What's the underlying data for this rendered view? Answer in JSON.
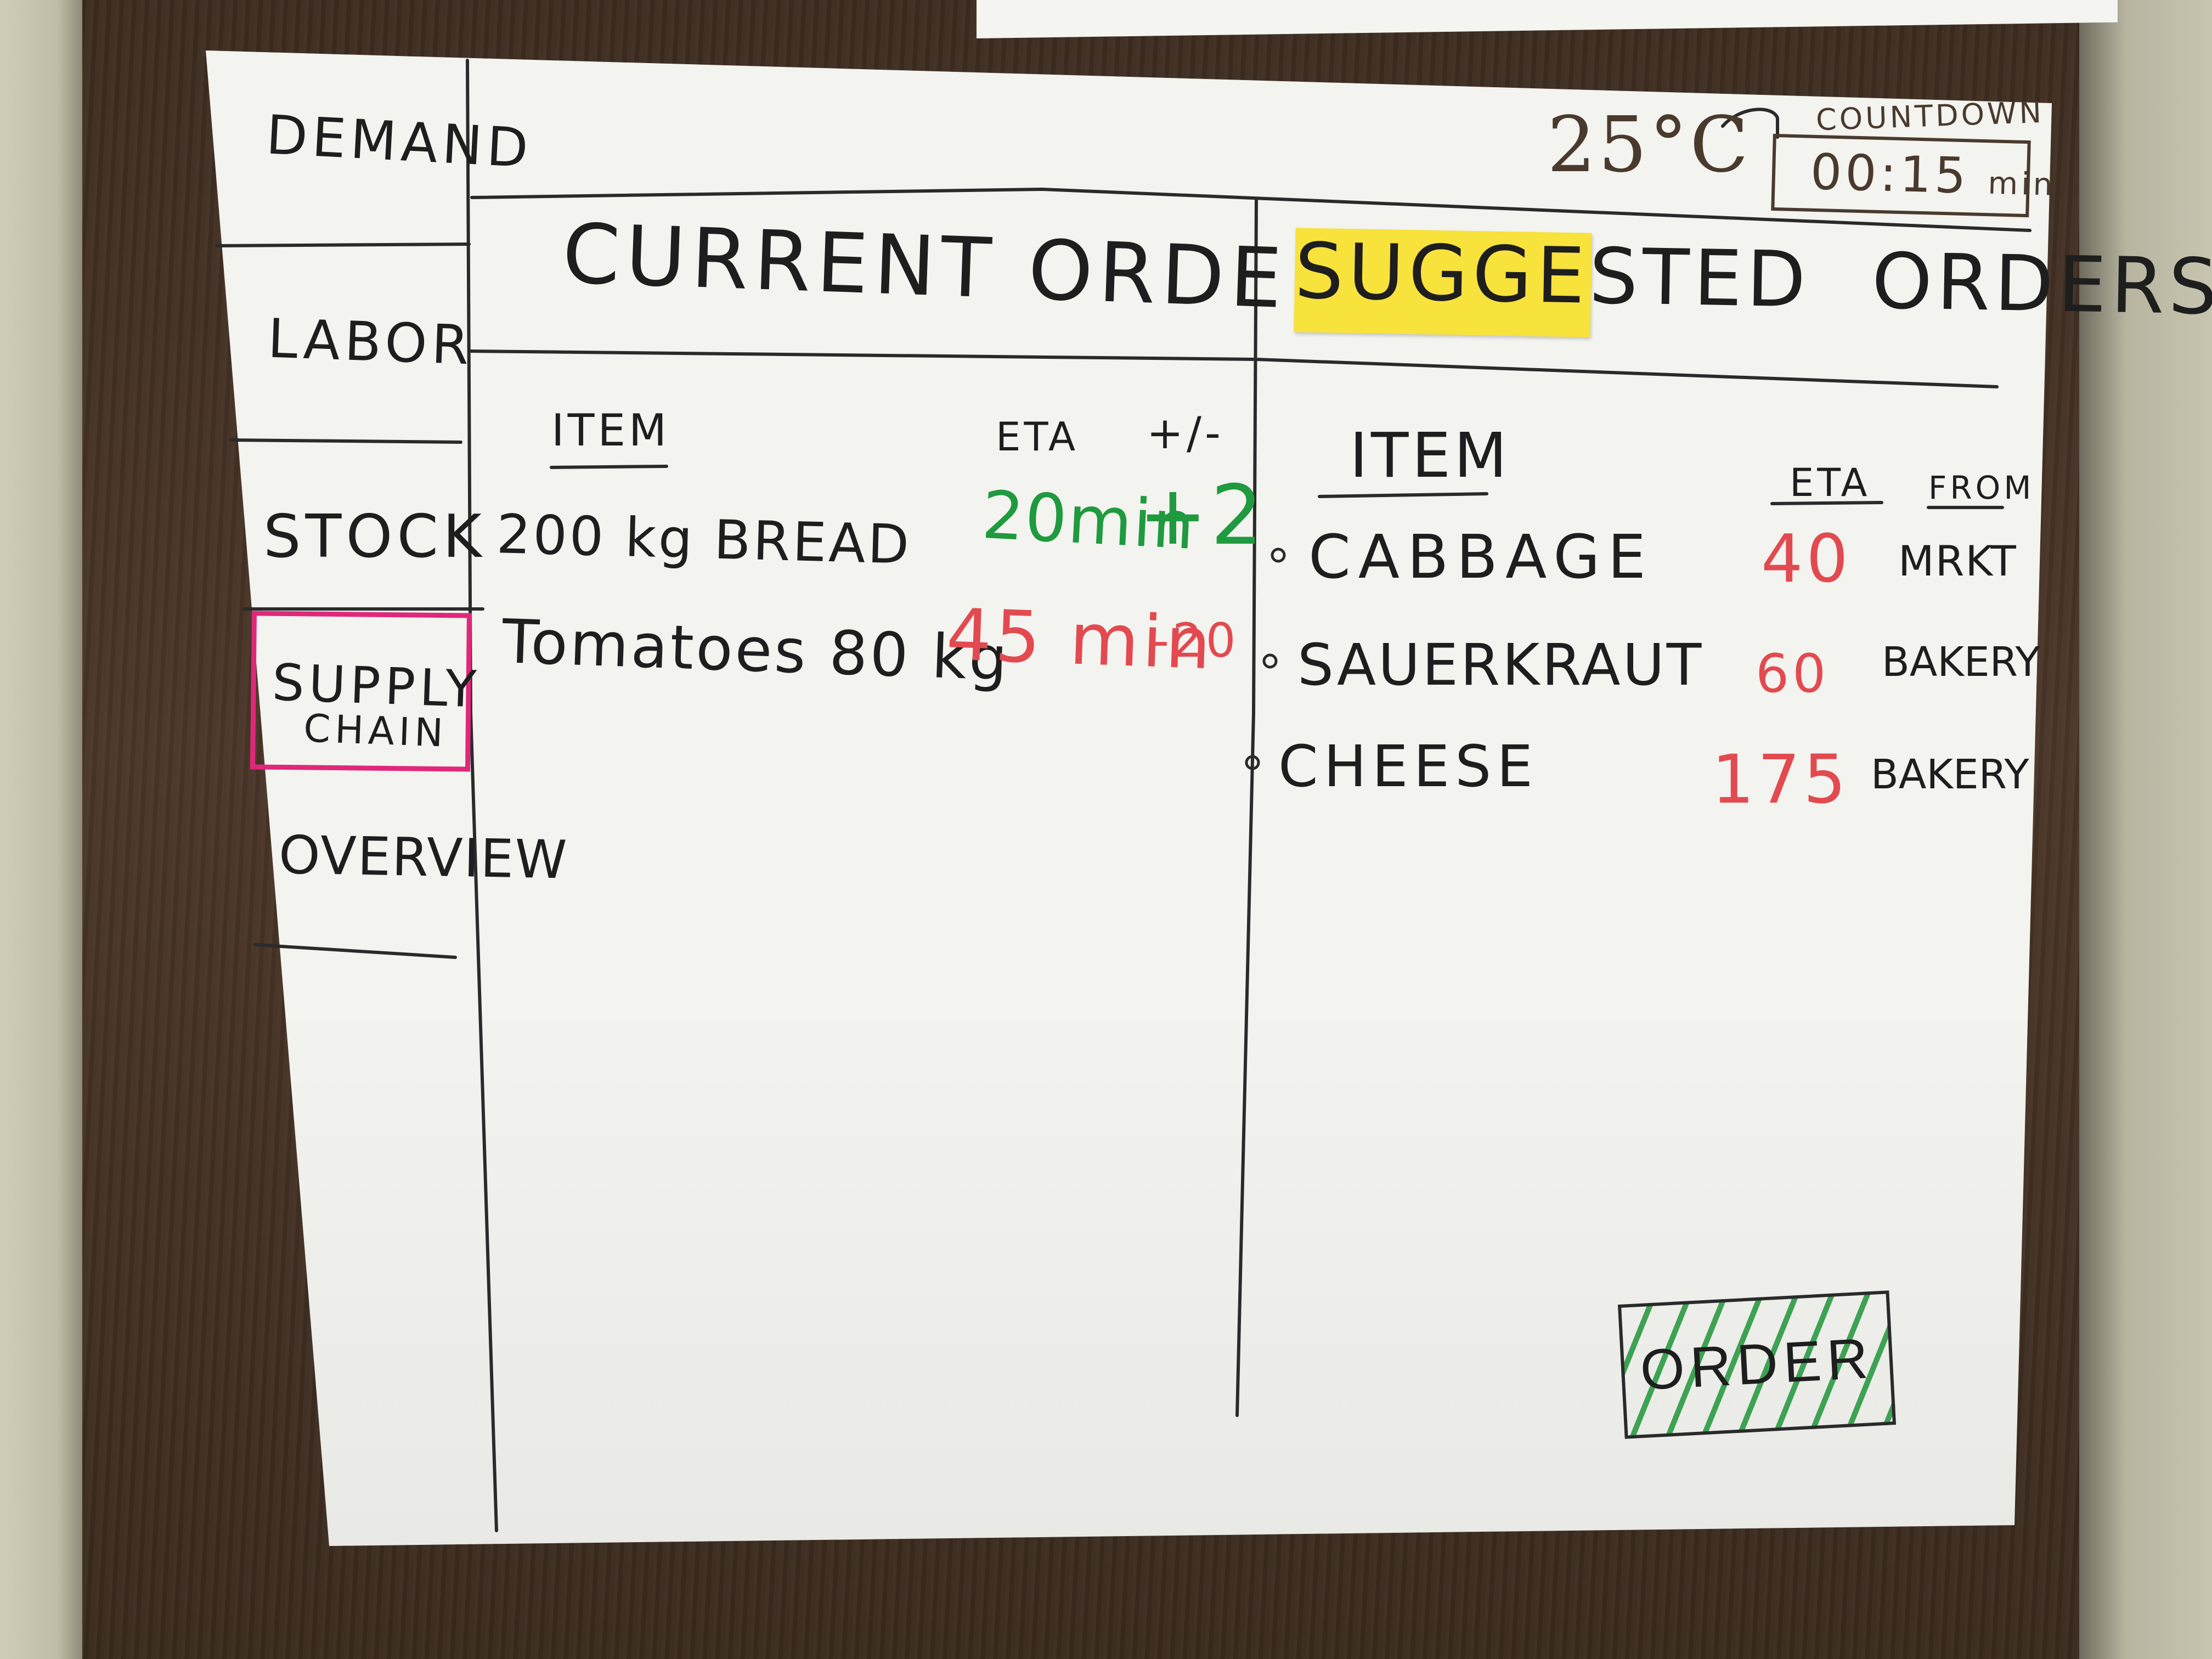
{
  "header": {
    "temperature": "25°C",
    "countdown_label": "COUNTDOWN",
    "countdown_value": "00:15",
    "countdown_unit": "min"
  },
  "sidebar": {
    "items": [
      {
        "label": "DEMAND"
      },
      {
        "label": "LABOR"
      },
      {
        "label": "STOCK"
      },
      {
        "label_line1": "SUPPLY",
        "label_line2": "CHAIN",
        "active": true
      },
      {
        "label": "OVERVIEW"
      }
    ]
  },
  "current_orders": {
    "title": "CURRENT ORDERS",
    "columns": {
      "item": "ITEM",
      "eta": "ETA",
      "delta": "+/-"
    },
    "rows": [
      {
        "item": "200 kg   BREAD",
        "eta": "20min",
        "delta": "+2",
        "status": "green"
      },
      {
        "item": "Tomatoes  80 kg",
        "eta": "45 min",
        "delta": "-20",
        "status": "red"
      }
    ]
  },
  "suggested_orders": {
    "title_highlight": "SUGGESTED",
    "title_rest": "ORDERS",
    "columns": {
      "item": "ITEM",
      "eta": "ETA",
      "from": "FROM"
    },
    "rows": [
      {
        "item": "CABBAGE",
        "eta": "40",
        "from": "MRKT"
      },
      {
        "item": "SAUERKRAUT",
        "eta": "60",
        "from": "BAKERY"
      },
      {
        "item": "CHEESE",
        "eta": "175",
        "from": "BAKERY"
      }
    ]
  },
  "actions": {
    "order_label": "ORDER"
  },
  "colors": {
    "ink": "#1e1e1e",
    "positive": "#1f9a3e",
    "negative": "#e24a50",
    "highlight": "#f8e23c",
    "active_nav": "#e0287a",
    "header_ink": "#4a3a2e"
  }
}
